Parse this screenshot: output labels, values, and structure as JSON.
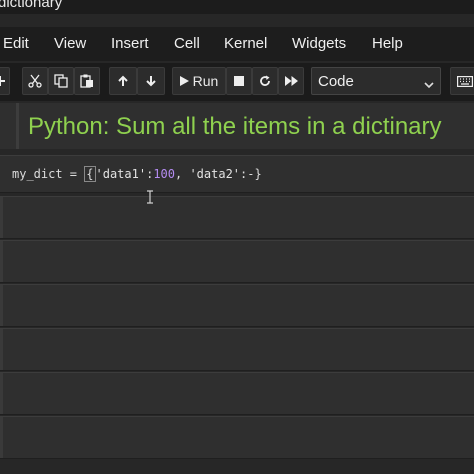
{
  "window": {
    "title": "dictionary"
  },
  "menubar": {
    "items": [
      {
        "label": "Edit"
      },
      {
        "label": "View"
      },
      {
        "label": "Insert"
      },
      {
        "label": "Cell"
      },
      {
        "label": "Kernel"
      },
      {
        "label": "Widgets"
      },
      {
        "label": "Help"
      }
    ]
  },
  "toolbar": {
    "icons": [
      "plus-icon",
      "cut-icon",
      "copy-icon",
      "paste-icon",
      "arrow-up-icon",
      "arrow-down-icon",
      "run-icon",
      "stop-icon",
      "restart-icon",
      "fast-forward-icon",
      "keyboard-icon"
    ],
    "run_label": "Run",
    "cell_type": "Code"
  },
  "notebook": {
    "heading": "Python: Sum all the items in a dictinary",
    "code": {
      "var": "my_dict",
      "eq": " = ",
      "open_brace": "{",
      "key1": "'data1'",
      "colon1": ":",
      "num1": "100",
      "sep": ", ",
      "key2": "'data2'",
      "colon2": ":",
      "rest": "-}"
    },
    "empty_cells": 6
  },
  "colors": {
    "heading": "#8fd14f",
    "number": "#b58cf2",
    "background": "#272727"
  }
}
